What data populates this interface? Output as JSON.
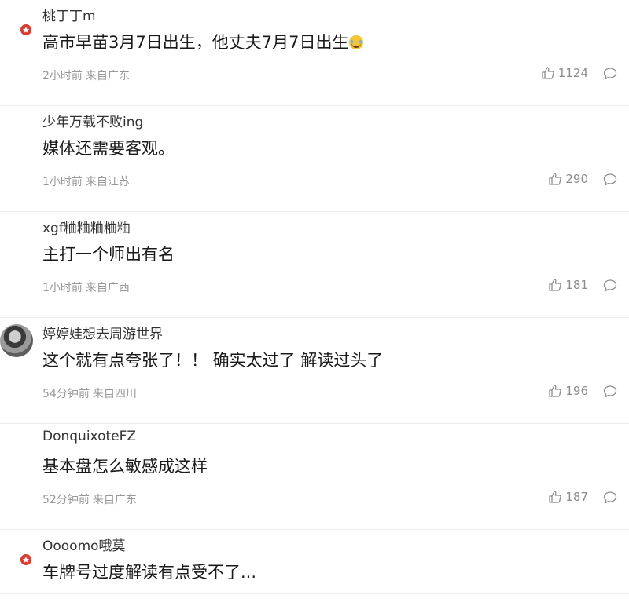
{
  "comments": [
    {
      "username": "桃丁丁m",
      "content": "高市早苗3月7日出生，他丈夫7月7日出生",
      "emoji": "grinning-sweat-emoji",
      "time": "2小时前",
      "location": "来自广东",
      "likes": "1124",
      "has_badge": true,
      "avatar": "blank"
    },
    {
      "username": "少年万载不败ing",
      "content": "媒体还需要客观。",
      "time": "1小时前",
      "location": "来自江苏",
      "likes": "290",
      "has_badge": false,
      "avatar": "blank"
    },
    {
      "username": "xgf粬粬粬粬粬",
      "content": "主打一个师出有名",
      "time": "1小时前",
      "location": "来自广西",
      "likes": "181",
      "has_badge": false,
      "avatar": "blank"
    },
    {
      "username": "婷婷娃想去周游世界",
      "content": "这个就有点夸张了！！ 确实太过了 解读过头了",
      "time": "54分钟前",
      "location": "来自四川",
      "likes": "196",
      "has_badge": false,
      "avatar": "photo"
    },
    {
      "username": "DonquixoteFZ",
      "content": "基本盘怎么敏感成这样",
      "time": "52分钟前",
      "location": "来自广东",
      "likes": "187",
      "has_badge": false,
      "avatar": "blank"
    },
    {
      "username": "Oooomo哦莫",
      "content": "车牌号过度解读有点受不了...",
      "time": "",
      "location": "",
      "likes": "",
      "has_badge": true,
      "avatar": "blank"
    }
  ],
  "colors": {
    "badge": "#e03a2f",
    "meta_text": "#999999",
    "divider": "#ececec"
  },
  "icons": {
    "like": "thumbs-up-icon",
    "reply": "comment-bubble-icon",
    "badge": "vip-badge-icon"
  }
}
